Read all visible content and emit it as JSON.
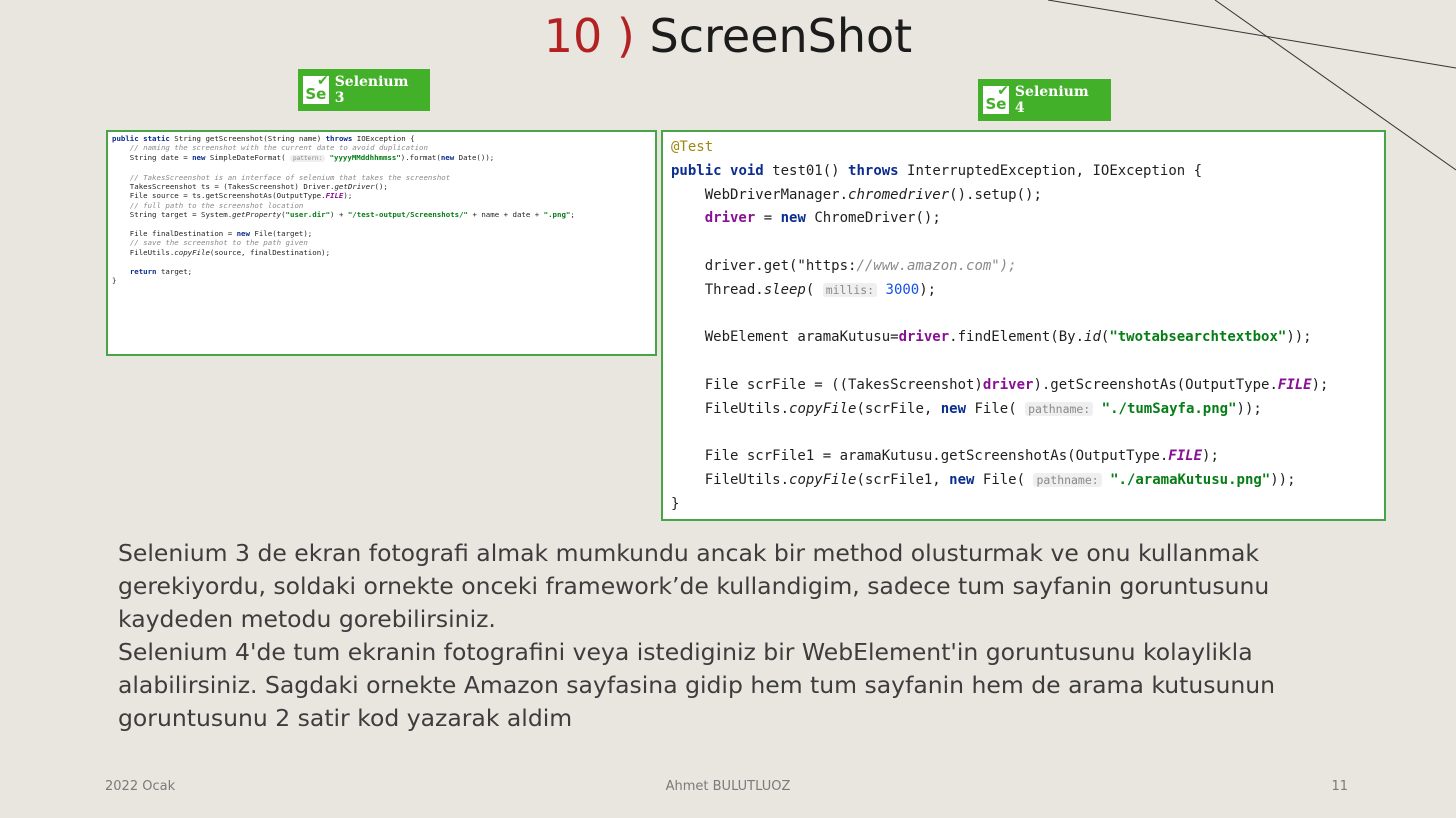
{
  "slide": {
    "title_number": "10 )",
    "title_text": "ScreenShot"
  },
  "badges": {
    "left": {
      "logo": "Se",
      "label": "Selenium 3"
    },
    "right": {
      "logo": "Se",
      "label": "Selenium 4"
    }
  },
  "code_left": [
    "public static String getScreenshot(String name) throws IOException {",
    "    // naming the screenshot with the current date to avoid duplication",
    "    String date = new SimpleDateFormat( pattern: \"yyyyMMddhhmmss\").format(new Date());",
    "",
    "    // TakesScreenshot is an interface of selenium that takes the screenshot",
    "    TakesScreenshot ts = (TakesScreenshot) Driver.getDriver();",
    "    File source = ts.getScreenshotAs(OutputType.FILE);",
    "    // full path to the screenshot location",
    "    String target = System.getProperty(\"user.dir\") + \"/test-output/Screenshots/\" + name + date + \".png\";",
    "",
    "    File finalDestination = new File(target);",
    "    // save the screenshot to the path given",
    "    FileUtils.copyFile(source, finalDestination);",
    "",
    "    return target;",
    "}"
  ],
  "code_right": [
    "@Test",
    "public void test01() throws InterruptedException, IOException {",
    "    WebDriverManager.chromedriver().setup();",
    "    driver = new ChromeDriver();",
    "",
    "    driver.get(\"https://www.amazon.com\");",
    "    Thread.sleep( millis: 3000);",
    "",
    "    WebElement aramaKutusu=driver.findElement(By.id(\"twotabsearchtextbox\"));",
    "",
    "    File scrFile = ((TakesScreenshot)driver).getScreenshotAs(OutputType.FILE);",
    "    FileUtils.copyFile(scrFile, new File( pathname: \"./tumSayfa.png\"));",
    "",
    "    File scrFile1 = aramaKutusu.getScreenshotAs(OutputType.FILE);",
    "    FileUtils.copyFile(scrFile1, new File( pathname: \"./aramaKutusu.png\"));",
    "}"
  ],
  "description": {
    "paragraph1": "Selenium 3 de ekran fotografi almak mumkundu ancak bir method olusturmak ve onu kullanmak gerekiyordu, soldaki ornekte onceki framework’de kullandigim, sadece tum sayfanin goruntusunu kaydeden metodu gorebilirsiniz.",
    "paragraph2": "Selenium 4'de tum ekranin fotografini veya istediginiz bir WebElement'in goruntusunu kolaylikla alabilirsiniz. Sagdaki ornekte Amazon sayfasina gidip hem tum sayfanin hem de arama kutusunun goruntusunu 2 satir kod yazarak aldim"
  },
  "footer": {
    "date": "2022 Ocak",
    "author": "Ahmet BULUTLUOZ",
    "page": "11"
  },
  "colors": {
    "background": "#e9e6e0",
    "title_number": "#b22222",
    "badge_green": "#43b02a",
    "code_border": "#47a447"
  },
  "icons": {
    "selenium_logo": "selenium-logo-icon"
  }
}
